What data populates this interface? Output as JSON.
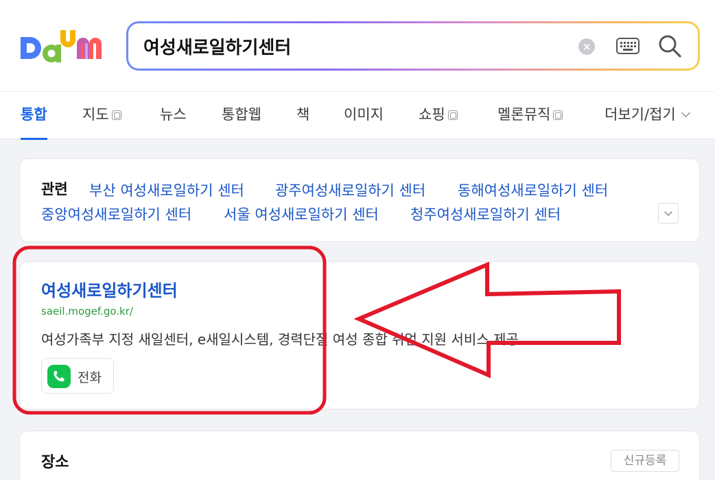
{
  "logo": {
    "text": "Daum",
    "colors": [
      "#4a7cf6",
      "#f4b400",
      "#7ac143",
      "#9b5cf2",
      "#ff5a5a"
    ]
  },
  "search": {
    "value": "여성새로일하기센터",
    "clear_icon": "close-circle-icon",
    "keyboard_icon": "keyboard-icon",
    "search_icon": "magnifier-icon"
  },
  "tabs": [
    {
      "label": "통합",
      "active": true
    },
    {
      "label": "지도",
      "external": true
    },
    {
      "label": "뉴스"
    },
    {
      "label": "통합웹"
    },
    {
      "label": "책"
    },
    {
      "label": "이미지"
    },
    {
      "label": "쇼핑",
      "external": true
    },
    {
      "label": "멜론뮤직",
      "external": true
    },
    {
      "label": "더보기/접기"
    }
  ],
  "related": {
    "heading": "관련",
    "links": [
      "부산 여성새로일하기 센터",
      "광주여성새로일하기 센터",
      "동해여성새로일하기 센터",
      "중앙여성새로일하기 센터",
      "서울 여성새로일하기 센터",
      "청주여성새로일하기 센터"
    ]
  },
  "result": {
    "title": "여성새로일하기센터",
    "url": "saeil.mogef.go.kr/",
    "description": "여성가족부 지정 새일센터, e새일시스템, 경력단절 여성 종합 취업 지원 서비스 제공.",
    "call_label": "전화"
  },
  "place": {
    "title": "장소",
    "register_label": "신규등록"
  },
  "colors": {
    "accent": "#1a66e8",
    "link": "#1a56c8",
    "url": "#2a9b3c",
    "annotation": "#e2192b",
    "call_green": "#13c14f"
  }
}
